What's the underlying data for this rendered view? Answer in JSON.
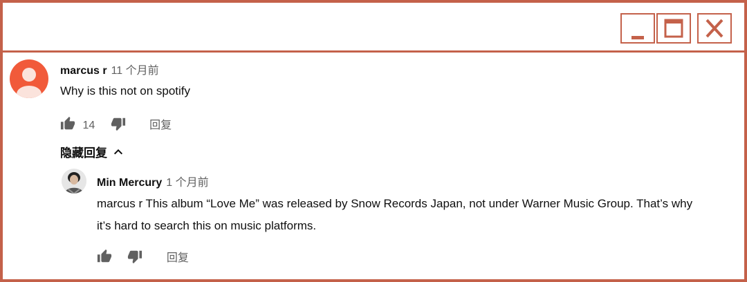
{
  "window": {
    "controls": [
      "minimize",
      "maximize",
      "close"
    ],
    "accent_color": "#c4614a"
  },
  "comment": {
    "author": "marcus r",
    "time": "11 个月前",
    "text": "Why is this not on spotify",
    "likes": "14",
    "reply_label": "回复",
    "avatar_color": "#f15a3a"
  },
  "replies_toggle": {
    "label": "隐藏回复",
    "icon": "chevron-up-icon"
  },
  "reply": {
    "author": "Min Mercury",
    "time": "1 个月前",
    "text_line1": "marcus r This album “Love Me” was released by Snow Records Japan, not under Warner Music Group. That’s why",
    "text_line2": "it’s hard to search this on music platforms.",
    "reply_label": "回复"
  }
}
